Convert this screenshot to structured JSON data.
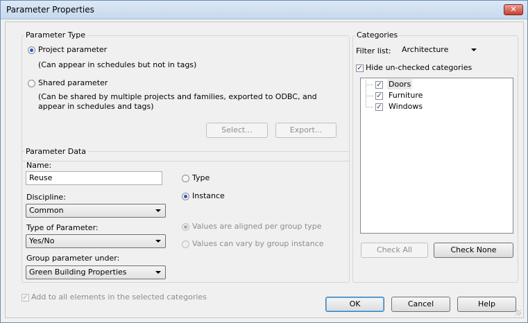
{
  "window": {
    "title": "Parameter Properties",
    "close_glyph": "✕"
  },
  "parameter_type": {
    "legend": "Parameter Type",
    "project_label": "Project parameter",
    "project_desc": "(Can appear in schedules but not in tags)",
    "shared_label": "Shared parameter",
    "shared_desc_line1": "(Can be shared by multiple projects and families, exported to ODBC, and",
    "shared_desc_line2": "appear in schedules and tags)",
    "select_label": "Select...",
    "export_label": "Export...",
    "selected": "project"
  },
  "parameter_data": {
    "legend": "Parameter Data",
    "name_label": "Name:",
    "name_value": "Reuse",
    "discipline_label": "Discipline:",
    "discipline_value": "Common",
    "type_label": "Type of Parameter:",
    "type_value": "Yes/No",
    "group_label": "Group parameter under:",
    "group_value": "Green Building Properties",
    "type_radio_label": "Type",
    "instance_radio_label": "Instance",
    "aligned_label": "Values are aligned per group type",
    "vary_label": "Values can vary by group instance"
  },
  "categories": {
    "legend": "Categories",
    "filter_label": "Filter list:",
    "filter_value": "Architecture",
    "hide_label": "Hide un-checked categories",
    "items": [
      {
        "label": "Doors",
        "checked": true
      },
      {
        "label": "Furniture",
        "checked": true
      },
      {
        "label": "Windows",
        "checked": true
      }
    ],
    "check_all_label": "Check All",
    "check_none_label": "Check None"
  },
  "footer": {
    "add_all_label": "Add to all elements in the selected categories",
    "ok_label": "OK",
    "cancel_label": "Cancel",
    "help_label": "Help"
  },
  "check_glyph": "✓"
}
